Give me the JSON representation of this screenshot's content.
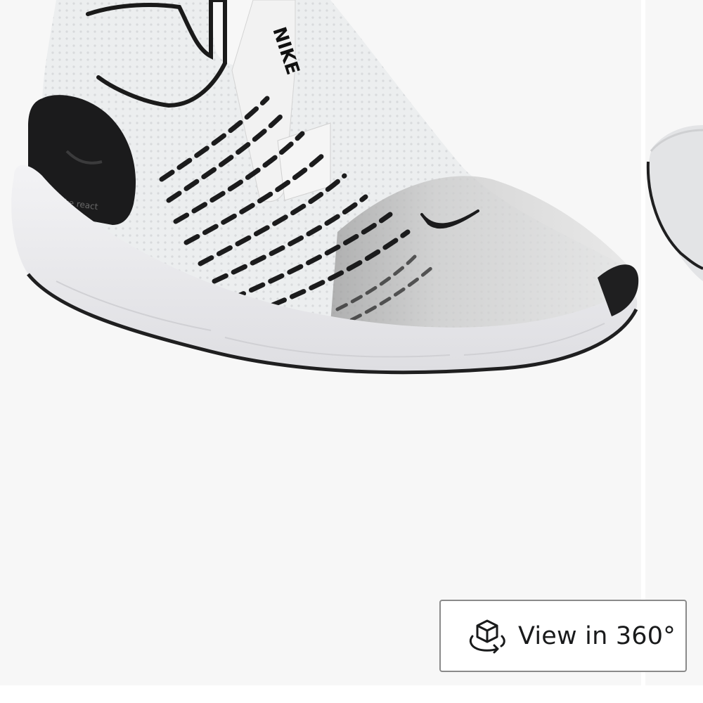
{
  "product_image": {
    "brand_label": "NIKE",
    "sole_label": "nike react",
    "alt": "Nike React Phantom Run Flyknit 2 sneaker"
  },
  "view_360_button": {
    "label": "View in 360°",
    "icon": "cube-rotate-icon"
  },
  "colors": {
    "viewer_bg": "#f7f7f7",
    "button_border": "#8a8a8a",
    "text": "#191a1b"
  }
}
